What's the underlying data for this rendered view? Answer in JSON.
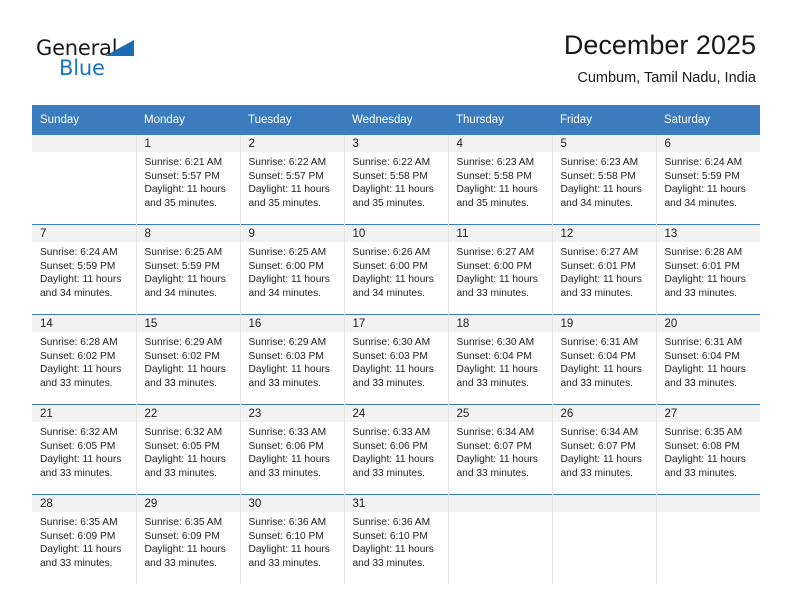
{
  "brand": {
    "name_part1": "General",
    "name_part2": "Blue",
    "flag_icon": "triangle-flag-icon"
  },
  "header": {
    "title": "December 2025",
    "subtitle": "Cumbum, Tamil Nadu, India"
  },
  "colors": {
    "header_blue": "#3a7cbe",
    "brand_blue": "#1b75bc",
    "band_gray": "#f2f2f2",
    "text": "#222222"
  },
  "labels": {
    "sunrise_prefix": "Sunrise:",
    "sunset_prefix": "Sunset:",
    "daylight_prefix": "Daylight:"
  },
  "weekday_headers": [
    "Sunday",
    "Monday",
    "Tuesday",
    "Wednesday",
    "Thursday",
    "Friday",
    "Saturday"
  ],
  "weeks": [
    [
      {
        "day": "",
        "sunrise": "",
        "sunset": "",
        "daylight_line1": "",
        "daylight_line2": "",
        "empty": true
      },
      {
        "day": "1",
        "sunrise": "Sunrise: 6:21 AM",
        "sunset": "Sunset: 5:57 PM",
        "daylight_line1": "Daylight: 11 hours",
        "daylight_line2": "and 35 minutes.",
        "empty": false
      },
      {
        "day": "2",
        "sunrise": "Sunrise: 6:22 AM",
        "sunset": "Sunset: 5:57 PM",
        "daylight_line1": "Daylight: 11 hours",
        "daylight_line2": "and 35 minutes.",
        "empty": false
      },
      {
        "day": "3",
        "sunrise": "Sunrise: 6:22 AM",
        "sunset": "Sunset: 5:58 PM",
        "daylight_line1": "Daylight: 11 hours",
        "daylight_line2": "and 35 minutes.",
        "empty": false
      },
      {
        "day": "4",
        "sunrise": "Sunrise: 6:23 AM",
        "sunset": "Sunset: 5:58 PM",
        "daylight_line1": "Daylight: 11 hours",
        "daylight_line2": "and 35 minutes.",
        "empty": false
      },
      {
        "day": "5",
        "sunrise": "Sunrise: 6:23 AM",
        "sunset": "Sunset: 5:58 PM",
        "daylight_line1": "Daylight: 11 hours",
        "daylight_line2": "and 34 minutes.",
        "empty": false
      },
      {
        "day": "6",
        "sunrise": "Sunrise: 6:24 AM",
        "sunset": "Sunset: 5:59 PM",
        "daylight_line1": "Daylight: 11 hours",
        "daylight_line2": "and 34 minutes.",
        "empty": false
      }
    ],
    [
      {
        "day": "7",
        "sunrise": "Sunrise: 6:24 AM",
        "sunset": "Sunset: 5:59 PM",
        "daylight_line1": "Daylight: 11 hours",
        "daylight_line2": "and 34 minutes.",
        "empty": false
      },
      {
        "day": "8",
        "sunrise": "Sunrise: 6:25 AM",
        "sunset": "Sunset: 5:59 PM",
        "daylight_line1": "Daylight: 11 hours",
        "daylight_line2": "and 34 minutes.",
        "empty": false
      },
      {
        "day": "9",
        "sunrise": "Sunrise: 6:25 AM",
        "sunset": "Sunset: 6:00 PM",
        "daylight_line1": "Daylight: 11 hours",
        "daylight_line2": "and 34 minutes.",
        "empty": false
      },
      {
        "day": "10",
        "sunrise": "Sunrise: 6:26 AM",
        "sunset": "Sunset: 6:00 PM",
        "daylight_line1": "Daylight: 11 hours",
        "daylight_line2": "and 34 minutes.",
        "empty": false
      },
      {
        "day": "11",
        "sunrise": "Sunrise: 6:27 AM",
        "sunset": "Sunset: 6:00 PM",
        "daylight_line1": "Daylight: 11 hours",
        "daylight_line2": "and 33 minutes.",
        "empty": false
      },
      {
        "day": "12",
        "sunrise": "Sunrise: 6:27 AM",
        "sunset": "Sunset: 6:01 PM",
        "daylight_line1": "Daylight: 11 hours",
        "daylight_line2": "and 33 minutes.",
        "empty": false
      },
      {
        "day": "13",
        "sunrise": "Sunrise: 6:28 AM",
        "sunset": "Sunset: 6:01 PM",
        "daylight_line1": "Daylight: 11 hours",
        "daylight_line2": "and 33 minutes.",
        "empty": false
      }
    ],
    [
      {
        "day": "14",
        "sunrise": "Sunrise: 6:28 AM",
        "sunset": "Sunset: 6:02 PM",
        "daylight_line1": "Daylight: 11 hours",
        "daylight_line2": "and 33 minutes.",
        "empty": false
      },
      {
        "day": "15",
        "sunrise": "Sunrise: 6:29 AM",
        "sunset": "Sunset: 6:02 PM",
        "daylight_line1": "Daylight: 11 hours",
        "daylight_line2": "and 33 minutes.",
        "empty": false
      },
      {
        "day": "16",
        "sunrise": "Sunrise: 6:29 AM",
        "sunset": "Sunset: 6:03 PM",
        "daylight_line1": "Daylight: 11 hours",
        "daylight_line2": "and 33 minutes.",
        "empty": false
      },
      {
        "day": "17",
        "sunrise": "Sunrise: 6:30 AM",
        "sunset": "Sunset: 6:03 PM",
        "daylight_line1": "Daylight: 11 hours",
        "daylight_line2": "and 33 minutes.",
        "empty": false
      },
      {
        "day": "18",
        "sunrise": "Sunrise: 6:30 AM",
        "sunset": "Sunset: 6:04 PM",
        "daylight_line1": "Daylight: 11 hours",
        "daylight_line2": "and 33 minutes.",
        "empty": false
      },
      {
        "day": "19",
        "sunrise": "Sunrise: 6:31 AM",
        "sunset": "Sunset: 6:04 PM",
        "daylight_line1": "Daylight: 11 hours",
        "daylight_line2": "and 33 minutes.",
        "empty": false
      },
      {
        "day": "20",
        "sunrise": "Sunrise: 6:31 AM",
        "sunset": "Sunset: 6:04 PM",
        "daylight_line1": "Daylight: 11 hours",
        "daylight_line2": "and 33 minutes.",
        "empty": false
      }
    ],
    [
      {
        "day": "21",
        "sunrise": "Sunrise: 6:32 AM",
        "sunset": "Sunset: 6:05 PM",
        "daylight_line1": "Daylight: 11 hours",
        "daylight_line2": "and 33 minutes.",
        "empty": false
      },
      {
        "day": "22",
        "sunrise": "Sunrise: 6:32 AM",
        "sunset": "Sunset: 6:05 PM",
        "daylight_line1": "Daylight: 11 hours",
        "daylight_line2": "and 33 minutes.",
        "empty": false
      },
      {
        "day": "23",
        "sunrise": "Sunrise: 6:33 AM",
        "sunset": "Sunset: 6:06 PM",
        "daylight_line1": "Daylight: 11 hours",
        "daylight_line2": "and 33 minutes.",
        "empty": false
      },
      {
        "day": "24",
        "sunrise": "Sunrise: 6:33 AM",
        "sunset": "Sunset: 6:06 PM",
        "daylight_line1": "Daylight: 11 hours",
        "daylight_line2": "and 33 minutes.",
        "empty": false
      },
      {
        "day": "25",
        "sunrise": "Sunrise: 6:34 AM",
        "sunset": "Sunset: 6:07 PM",
        "daylight_line1": "Daylight: 11 hours",
        "daylight_line2": "and 33 minutes.",
        "empty": false
      },
      {
        "day": "26",
        "sunrise": "Sunrise: 6:34 AM",
        "sunset": "Sunset: 6:07 PM",
        "daylight_line1": "Daylight: 11 hours",
        "daylight_line2": "and 33 minutes.",
        "empty": false
      },
      {
        "day": "27",
        "sunrise": "Sunrise: 6:35 AM",
        "sunset": "Sunset: 6:08 PM",
        "daylight_line1": "Daylight: 11 hours",
        "daylight_line2": "and 33 minutes.",
        "empty": false
      }
    ],
    [
      {
        "day": "28",
        "sunrise": "Sunrise: 6:35 AM",
        "sunset": "Sunset: 6:09 PM",
        "daylight_line1": "Daylight: 11 hours",
        "daylight_line2": "and 33 minutes.",
        "empty": false
      },
      {
        "day": "29",
        "sunrise": "Sunrise: 6:35 AM",
        "sunset": "Sunset: 6:09 PM",
        "daylight_line1": "Daylight: 11 hours",
        "daylight_line2": "and 33 minutes.",
        "empty": false
      },
      {
        "day": "30",
        "sunrise": "Sunrise: 6:36 AM",
        "sunset": "Sunset: 6:10 PM",
        "daylight_line1": "Daylight: 11 hours",
        "daylight_line2": "and 33 minutes.",
        "empty": false
      },
      {
        "day": "31",
        "sunrise": "Sunrise: 6:36 AM",
        "sunset": "Sunset: 6:10 PM",
        "daylight_line1": "Daylight: 11 hours",
        "daylight_line2": "and 33 minutes.",
        "empty": false
      },
      {
        "day": "",
        "sunrise": "",
        "sunset": "",
        "daylight_line1": "",
        "daylight_line2": "",
        "empty": true
      },
      {
        "day": "",
        "sunrise": "",
        "sunset": "",
        "daylight_line1": "",
        "daylight_line2": "",
        "empty": true
      },
      {
        "day": "",
        "sunrise": "",
        "sunset": "",
        "daylight_line1": "",
        "daylight_line2": "",
        "empty": true
      }
    ]
  ]
}
